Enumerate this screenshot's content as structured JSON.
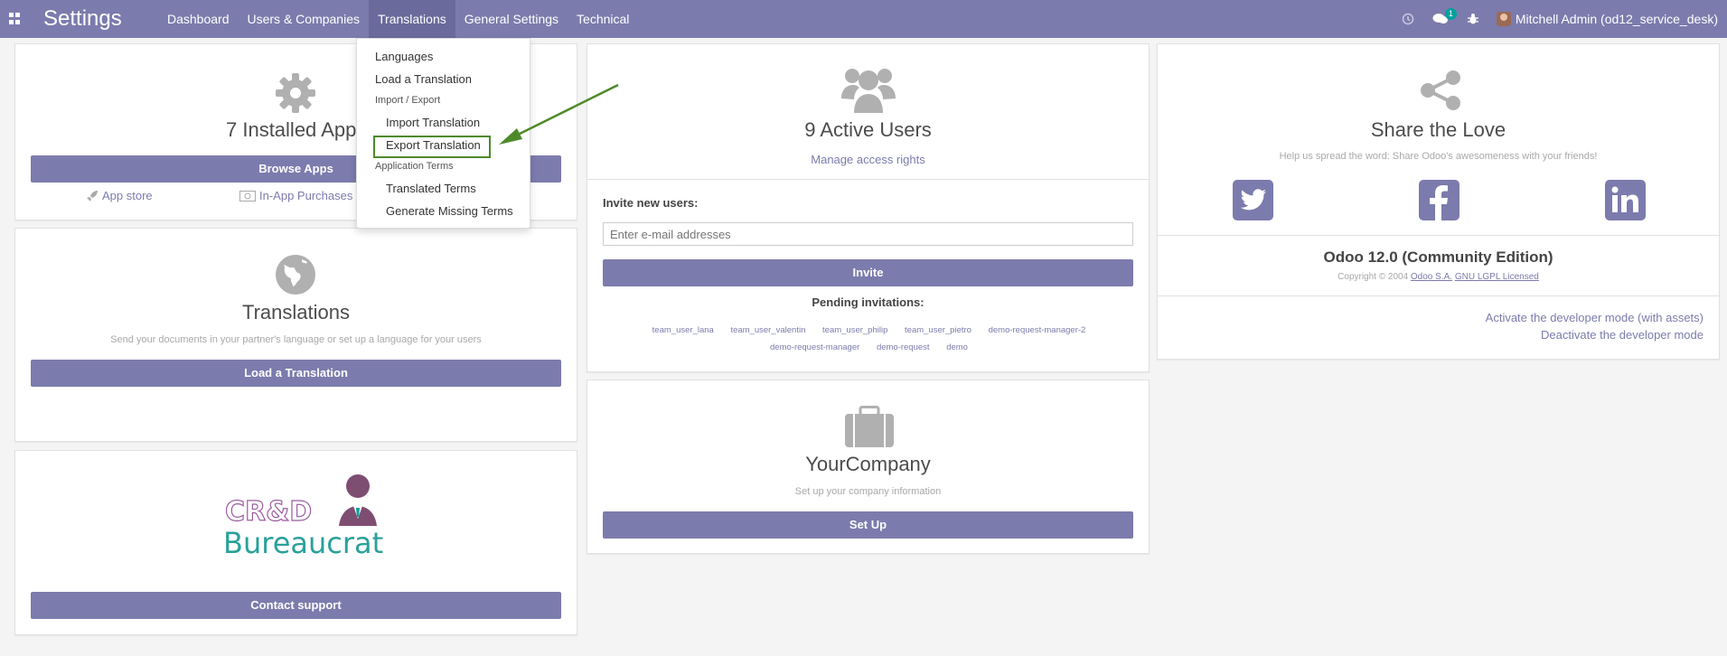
{
  "navbar": {
    "brand": "Settings",
    "menu": [
      "Dashboard",
      "Users & Companies",
      "Translations",
      "General Settings",
      "Technical"
    ],
    "badge_count": "1",
    "user": "Mitchell Admin (od12_service_desk)",
    "bg_color": "#7c7bad"
  },
  "dropdown": {
    "languages": "Languages",
    "load_translation": "Load a Translation",
    "import_export_header": "Import / Export",
    "import_translation": "Import Translation",
    "export_translation": "Export Translation",
    "app_terms_header": "Application Terms",
    "translated_terms": "Translated Terms",
    "generate_missing": "Generate Missing Terms"
  },
  "apps_card": {
    "title": "7 Installed Apps",
    "button": "Browse Apps",
    "app_store": "App store",
    "in_app": "In-App Purchases"
  },
  "translations_card": {
    "title": "Translations",
    "subtitle": "Send your documents in your partner's language or set up a language for your users",
    "button": "Load a Translation"
  },
  "support_card": {
    "logo_top": "CR&D",
    "logo_bottom": "Bureaucrat",
    "button": "Contact support"
  },
  "users_card": {
    "title": "9 Active Users",
    "manage_link": "Manage access rights",
    "invite_label": "Invite new users:",
    "email_placeholder": "Enter e-mail addresses",
    "invite_button": "Invite",
    "pending_label": "Pending invitations:",
    "pending": [
      "team_user_lana",
      "team_user_valentin",
      "team_user_philip",
      "team_user_pietro",
      "demo-request-manager-2",
      "demo-request-manager",
      "demo-request",
      "demo"
    ]
  },
  "company_card": {
    "title": "YourCompany",
    "subtitle": "Set up your company information",
    "button": "Set Up"
  },
  "share_card": {
    "title": "Share the Love",
    "subtitle": "Help us spread the word: Share Odoo's awesomeness with your friends!",
    "edition": "Odoo 12.0 (Community Edition)",
    "copyright": "Copyright © 2004",
    "odoo_link": "Odoo S.A.",
    "license_link": "GNU LGPL Licensed",
    "dev_assets": "Activate the developer mode (with assets)",
    "dev_deactivate": "Deactivate the developer mode"
  }
}
